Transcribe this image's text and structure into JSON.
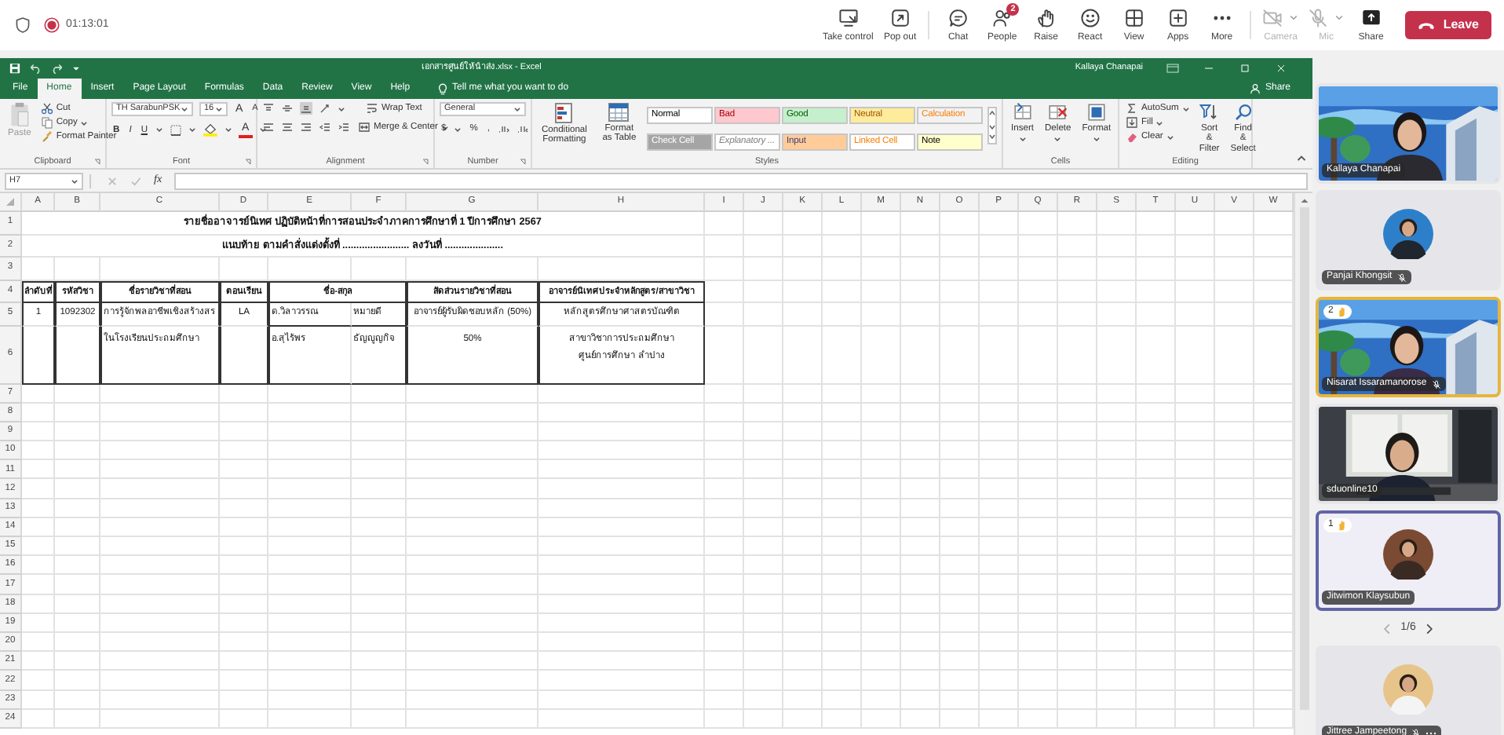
{
  "meeting": {
    "recording": true,
    "timer": "01:13:01",
    "controls": [
      {
        "label": "Take control",
        "disabled": false,
        "dropdown": false
      },
      {
        "label": "Pop out",
        "disabled": false,
        "dropdown": false
      },
      {
        "label": "Chat",
        "disabled": false,
        "dropdown": false
      },
      {
        "label": "People",
        "disabled": false,
        "dropdown": false,
        "badge": "2"
      },
      {
        "label": "Raise",
        "disabled": false,
        "dropdown": false
      },
      {
        "label": "React",
        "disabled": false,
        "dropdown": false
      },
      {
        "label": "View",
        "disabled": false,
        "dropdown": false
      },
      {
        "label": "Apps",
        "disabled": false,
        "dropdown": false
      },
      {
        "label": "More",
        "disabled": false,
        "dropdown": false
      },
      {
        "label": "Camera",
        "disabled": true,
        "dropdown": true
      },
      {
        "label": "Mic",
        "disabled": true,
        "dropdown": true
      },
      {
        "label": "Share",
        "disabled": false,
        "dropdown": false
      }
    ],
    "leave": "Leave"
  },
  "excel": {
    "file_title": "เอกสารศูนย์ให้นำส่ง.xlsx - Excel",
    "account": "Kallaya Chanapai",
    "tabs": [
      {
        "label": "File",
        "selected": false
      },
      {
        "label": "Home",
        "selected": true
      },
      {
        "label": "Insert",
        "selected": false
      },
      {
        "label": "Page Layout",
        "selected": false
      },
      {
        "label": "Formulas",
        "selected": false
      },
      {
        "label": "Data",
        "selected": false
      },
      {
        "label": "Review",
        "selected": false
      },
      {
        "label": "View",
        "selected": false
      },
      {
        "label": "Help",
        "selected": false
      }
    ],
    "tell_me": "Tell me what you want to do",
    "share": "Share",
    "ribbon": {
      "clipboard": {
        "label": "Clipboard",
        "paste": "Paste",
        "cut": "Cut",
        "copy": "Copy",
        "format_painter": "Format Painter"
      },
      "font": {
        "label": "Font",
        "name": "TH SarabunPSK",
        "size": "16",
        "grow": "A",
        "shrink": "A",
        "bold": "B",
        "italic": "I",
        "underline": "U",
        "font_color": "A"
      },
      "alignment": {
        "label": "Alignment",
        "wrap": "Wrap Text",
        "merge": "Merge & Center"
      },
      "number": {
        "label": "Number",
        "format": "General",
        "currency": "$",
        "percent": "%",
        "comma": ","
      },
      "styles": {
        "label": "Styles",
        "conditional": "Conditional Formatting",
        "table": "Format as Table",
        "cell_styles": [
          {
            "label": "Normal",
            "color": "#ffffff"
          },
          {
            "label": "Bad",
            "color": "#ffc7ce"
          },
          {
            "label": "Good",
            "color": "#c6efce"
          },
          {
            "label": "Neutral",
            "color": "#ffeb9c"
          },
          {
            "label": "Calculation",
            "color": "#f2f2f2"
          },
          {
            "label": "Check Cell",
            "color": "#a5a5a5"
          },
          {
            "label": "Explanatory ...",
            "color": "#ffffff"
          },
          {
            "label": "Input",
            "color": "#ffcc99"
          },
          {
            "label": "Linked Cell",
            "color": "#ffffff"
          },
          {
            "label": "Note",
            "color": "#ffffcc"
          }
        ]
      },
      "cells": {
        "label": "Cells",
        "buttons": [
          "Insert",
          "Delete",
          "Format"
        ]
      },
      "editing": {
        "label": "Editing",
        "autosum": "AutoSum",
        "fill": "Fill",
        "clear": "Clear",
        "sort": "Sort & Filter",
        "find": "Find & Select"
      }
    },
    "name_box": "H7",
    "fx": "fx",
    "columns": [
      "A",
      "B",
      "C",
      "D",
      "E",
      "F",
      "G",
      "H",
      "I",
      "J",
      "K",
      "L",
      "M",
      "N",
      "O",
      "P",
      "Q",
      "R",
      "S",
      "T",
      "U",
      "V",
      "W"
    ],
    "rows": [
      {
        "number": "1",
        "kind": "title",
        "cells": {
          "A": "รายชื่ออาจารย์นิเทศ ปฏิบัติหน้าที่การสอนประจำภาคการศึกษาที่ 1 ปีการศึกษา 2567"
        }
      },
      {
        "number": "2",
        "kind": "title",
        "cells": {
          "A": "แนบท้าย ตามคำสั่งแต่งตั้งที่ ........................ ลงวันที่ ....................."
        }
      },
      {
        "number": "3",
        "kind": "empty"
      },
      {
        "number": "4",
        "kind": "header",
        "cells": {
          "A": "ลำดับที่",
          "B": "รหัสวิชา",
          "C": "ชื่อรายวิชาที่สอน",
          "D": "ตอนเรียน",
          "E": "ชื่อ-สกุล",
          "G": "สัดส่วนรายวิชาที่สอน",
          "H": "อาจารย์นิเทศประจำหลักสูตร/สาขาวิชา"
        }
      },
      {
        "number": "5",
        "kind": "data",
        "cells": {
          "A": "1",
          "B": "1092302",
          "C": "การรู้จักพลอาชีพเชิงสร้างสร",
          "D": "LA",
          "E": "ด.วิลาวรรณ",
          "F": "หมายดี",
          "G": "อาจารย์ผู้รับผิดชอบหลัก (50%)",
          "H": "หลักสูตรศึกษาศาสตรบัณฑิต"
        }
      },
      {
        "number": "6",
        "kind": "data",
        "cells": {
          "C": "ในโรงเรียนประถมศึกษา",
          "E": "อ.สุไร้พร",
          "F": "ธัญญูญกิจ",
          "G": "50%",
          "H": "สาขาวิชาการประถมศึกษา\nศูนย์การศึกษา ลำปาง"
        }
      },
      {
        "number": "7",
        "kind": "empty"
      },
      {
        "number": "8",
        "kind": "empty"
      },
      {
        "number": "9",
        "kind": "empty"
      },
      {
        "number": "10",
        "kind": "empty"
      },
      {
        "number": "11",
        "kind": "empty"
      },
      {
        "number": "12",
        "kind": "empty"
      },
      {
        "number": "13",
        "kind": "empty"
      },
      {
        "number": "14",
        "kind": "empty"
      },
      {
        "number": "15",
        "kind": "empty"
      },
      {
        "number": "16",
        "kind": "empty"
      },
      {
        "number": "17",
        "kind": "empty"
      },
      {
        "number": "18",
        "kind": "empty"
      },
      {
        "number": "19",
        "kind": "empty"
      },
      {
        "number": "20",
        "kind": "empty"
      },
      {
        "number": "21",
        "kind": "empty"
      },
      {
        "number": "22",
        "kind": "empty"
      },
      {
        "number": "23",
        "kind": "empty"
      },
      {
        "number": "24",
        "kind": "empty"
      }
    ]
  },
  "participants": [
    {
      "name": "Kallaya Chanapai",
      "kind": "video",
      "speaking": false,
      "selected": false,
      "muted": false,
      "more": false
    },
    {
      "name": "Panjai Khongsit",
      "kind": "avatar",
      "speaking": false,
      "selected": false,
      "muted": true,
      "more": false
    },
    {
      "name": "Nisarat Issaramanorose",
      "kind": "video",
      "speaking": true,
      "selected": false,
      "hand": "2",
      "muted": true,
      "more": false
    },
    {
      "name": "sduonline10",
      "kind": "video",
      "speaking": false,
      "selected": false,
      "muted": false,
      "more": false
    },
    {
      "name": "Jitwimon Klaysubun",
      "kind": "avatar",
      "speaking": false,
      "selected": true,
      "hand": "1",
      "muted": false,
      "more": false
    },
    {
      "name": "Jittree Jampeetong",
      "kind": "avatar",
      "speaking": false,
      "selected": false,
      "muted": true,
      "more": true
    }
  ],
  "pager": "1/6"
}
